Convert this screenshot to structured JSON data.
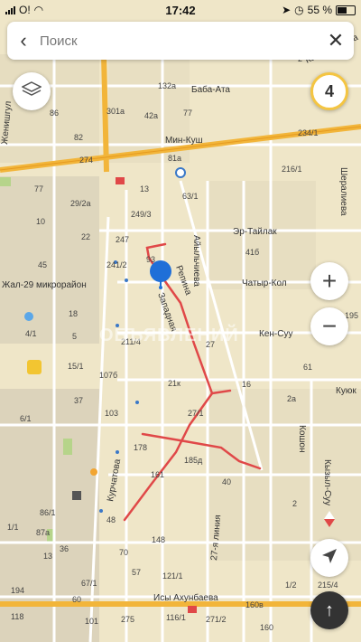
{
  "statusbar": {
    "carrier": "O!",
    "time": "17:42",
    "battery": "55 %"
  },
  "search": {
    "placeholder": "Поиск"
  },
  "traffic_level": "4",
  "watermark": "ОБЪЯВЛЕНИЙ",
  "colors": {
    "road_main": "#f2b53a",
    "road_minor": "#ffffff",
    "route": "#e04848",
    "pin": "#1f6fd8",
    "bg": "#efe6c8"
  },
  "streets": [
    "Баба-Ата",
    "Мин-Куш",
    "Эр-Тайлак",
    "Чатыр-Кол",
    "Кен-Суу",
    "Куюк",
    "Исы Ахунбаева",
    "Айыльчиева",
    "Репина",
    "Западная",
    "Курчатова",
    "27-я линия",
    "Кошон",
    "Кызыл-Суу",
    "Шералиева",
    "Женишгул",
    "Кан-Баба-Ата",
    "Жал-29 микрорайон"
  ],
  "house_numbers": [
    "132а",
    "301а",
    "2",
    "42а",
    "77",
    "86",
    "82",
    "81а",
    "274",
    "216/1",
    "234/1",
    "77",
    "29/2а",
    "249/3",
    "13",
    "63/1",
    "10",
    "22",
    "247",
    "93",
    "45",
    "241/2",
    "41б",
    "18",
    "4/1",
    "5",
    "211/4",
    "27",
    "61",
    "15/1",
    "107б",
    "21к",
    "16",
    "2а",
    "37",
    "6/1",
    "103",
    "27/1",
    "178",
    "161",
    "185д",
    "40",
    "2",
    "86/1",
    "48",
    "148",
    "87а",
    "1/1",
    "70",
    "36",
    "121/1",
    "13",
    "67/1",
    "194",
    "60",
    "57",
    "116/1",
    "271/2",
    "160в",
    "118",
    "101",
    "160",
    "275",
    "1/2",
    "215/4",
    "195"
  ],
  "icons": [
    "layers-icon",
    "search-back-icon",
    "close-icon",
    "plus-icon",
    "minus-icon",
    "locate-arrow-icon",
    "share-icon",
    "map-pin-icon",
    "compass-icon"
  ]
}
